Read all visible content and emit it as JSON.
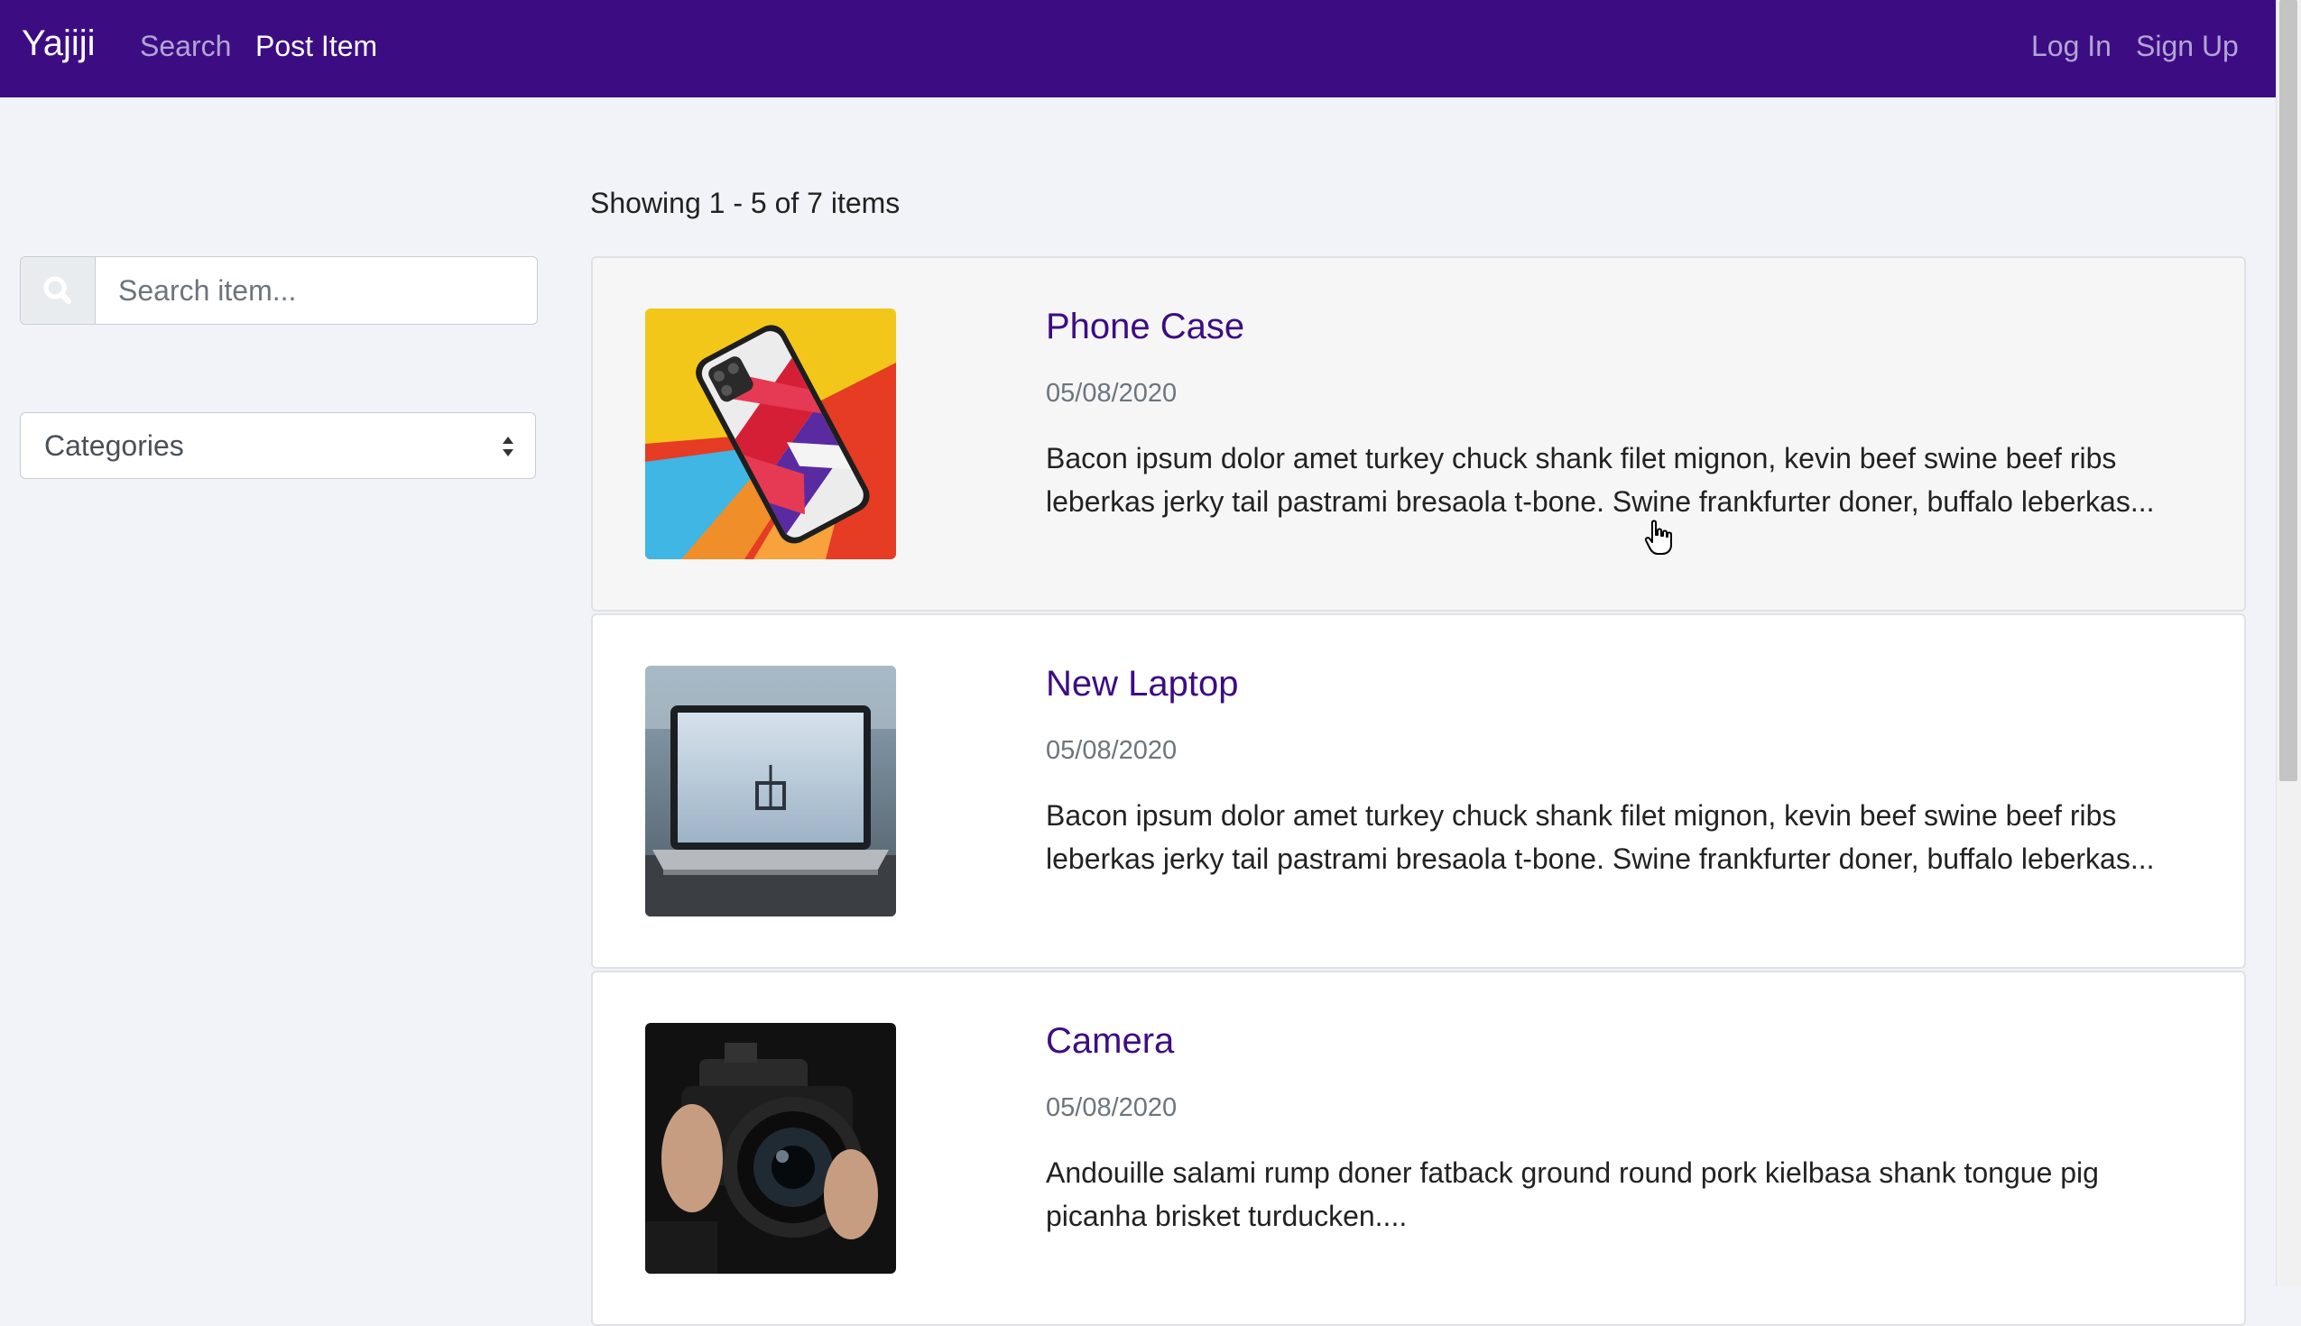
{
  "navbar": {
    "brand": "Yajiji",
    "search_link": "Search",
    "post_link": "Post Item",
    "login_link": "Log In",
    "signup_link": "Sign Up",
    "bg_color": "#3c0d82"
  },
  "sidebar": {
    "search_placeholder": "Search item...",
    "search_icon": "search-icon",
    "categories_label": "Categories"
  },
  "results": {
    "prefix": "Showing",
    "range": "1 - 5",
    "of_label": "of",
    "total": "7",
    "suffix": "items"
  },
  "items": [
    {
      "title": "Phone Case",
      "date": "05/08/2020",
      "description": "Bacon ipsum dolor amet turkey chuck shank filet mignon, kevin beef swine beef ribs leberkas jerky tail pastrami bresaola t-bone. Swine frankfurter doner, buffalo leberkas...",
      "image": "phone-case-photo"
    },
    {
      "title": "New Laptop",
      "date": "05/08/2020",
      "description": "Bacon ipsum dolor amet turkey chuck shank filet mignon, kevin beef swine beef ribs leberkas jerky tail pastrami bresaola t-bone. Swine frankfurter doner, buffalo leberkas...",
      "image": "laptop-photo"
    },
    {
      "title": "Camera",
      "date": "05/08/2020",
      "description": "Andouille salami rump doner fatback ground round pork kielbasa shank tongue pig picanha brisket turducken....",
      "image": "camera-photo"
    }
  ]
}
